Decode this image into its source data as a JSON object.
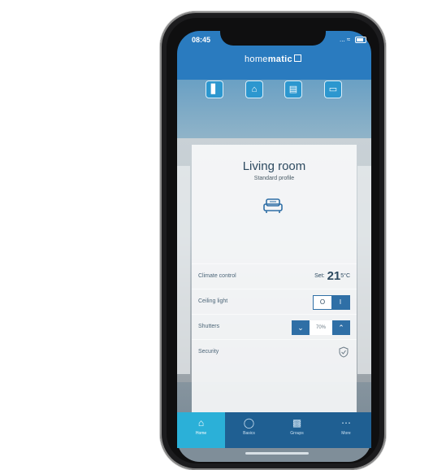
{
  "status_bar": {
    "time": "08:45",
    "signal": "..."
  },
  "app": {
    "brand_prefix": "home",
    "brand_suffix": "matic"
  },
  "top_icons": [
    "thermometer-icon",
    "house-icon",
    "window-icon",
    "display-icon"
  ],
  "room": {
    "title": "Living room",
    "subtitle": "Standard profile",
    "icon": "sofa-icon"
  },
  "rows": {
    "climate": {
      "label": "Climate control",
      "set_prefix": "Set:",
      "value": "21",
      "unit": "5°C"
    },
    "light": {
      "label": "Ceiling light",
      "off": "O",
      "on": "I"
    },
    "shutters": {
      "label": "Shutters",
      "value": "70%"
    },
    "security": {
      "label": "Security",
      "icon": "shield-check-icon"
    }
  },
  "tabs": [
    {
      "label": "Home",
      "icon": "home-icon",
      "active": true
    },
    {
      "label": "Basics",
      "icon": "basics-icon",
      "active": false
    },
    {
      "label": "Groups",
      "icon": "groups-icon",
      "active": false
    },
    {
      "label": "More",
      "icon": "more-icon",
      "active": false
    }
  ],
  "colors": {
    "accent": "#2bb0d8",
    "tabbar": "#1f5f92",
    "control": "#2f6fa6",
    "header": "#2a7bbf"
  }
}
